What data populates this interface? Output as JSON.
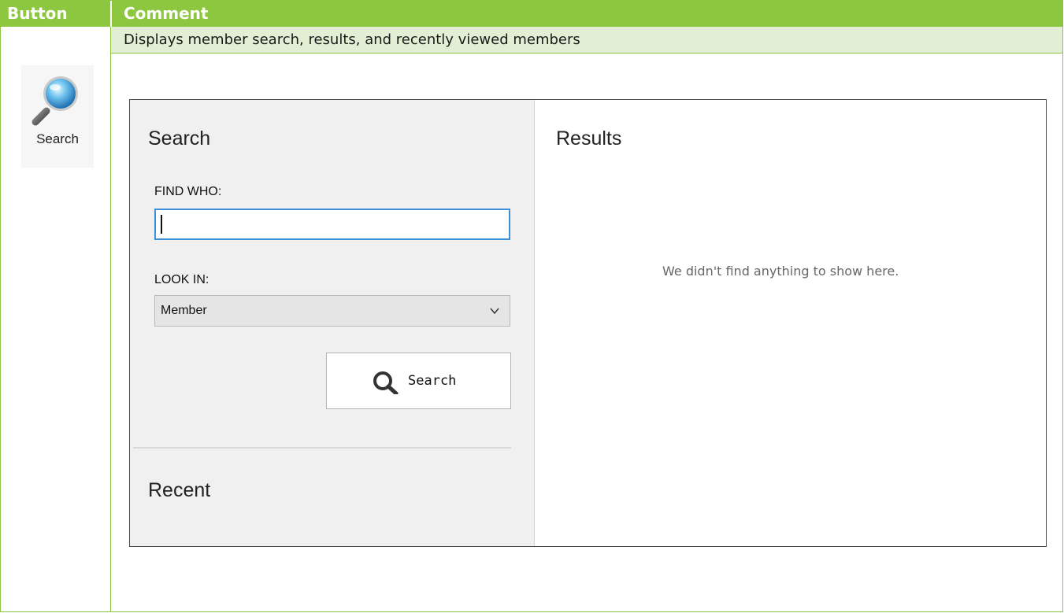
{
  "table": {
    "headers": {
      "button": "Button",
      "comment": "Comment"
    },
    "description": "Displays member search, results, and recently viewed members",
    "ribbon_button": {
      "label": "Search",
      "icon": "magnifier-icon"
    }
  },
  "app": {
    "search_panel": {
      "title": "Search",
      "find_who_label": "FIND WHO:",
      "find_who_value": "",
      "look_in_label": "LOOK IN:",
      "look_in_value": "Member",
      "search_button_label": "Search"
    },
    "recent_panel": {
      "title": "Recent"
    },
    "results_panel": {
      "title": "Results",
      "empty_message": "We didn't find anything to show here."
    }
  },
  "colors": {
    "header_green": "#8dc63f",
    "description_band": "#e3efd5",
    "input_focus_blue": "#3c8fd8"
  }
}
